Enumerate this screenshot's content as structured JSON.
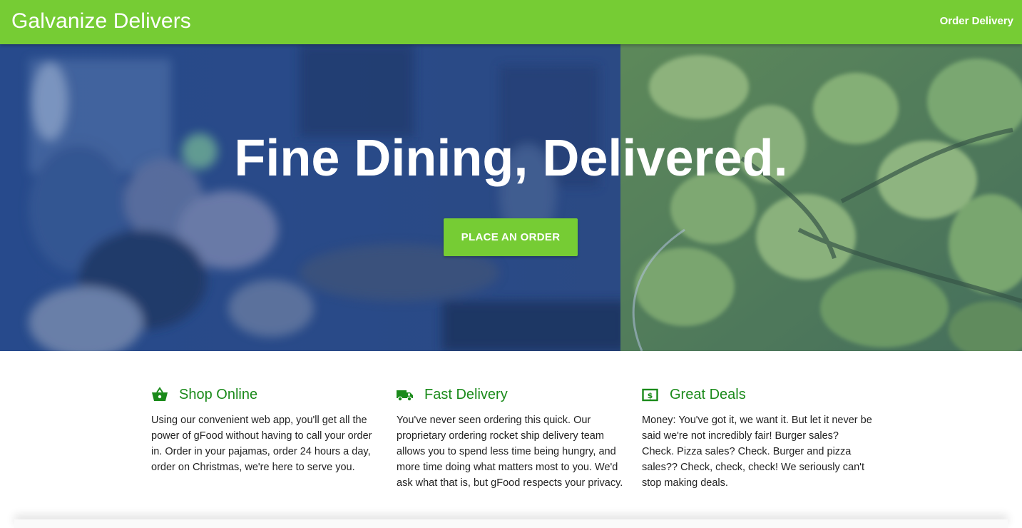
{
  "nav": {
    "brand": "Galvanize Delivers",
    "link": "Order Delivery"
  },
  "hero": {
    "title": "Fine Dining, Delivered.",
    "button": "PLACE AN ORDER"
  },
  "features": [
    {
      "icon": "basket-icon",
      "title": "Shop Online",
      "text": "Using our convenient web app, you'll get all the power of gFood without having to call your order in. Order in your pajamas, order 24 hours a day, order on Christmas, we're here to serve you."
    },
    {
      "icon": "truck-icon",
      "title": "Fast Delivery",
      "text": "You've never seen ordering this quick. Our proprietary ordering rocket ship delivery team allows you to spend less time being hungry, and more time doing what matters most to you. We'd ask what that is, but gFood respects your privacy."
    },
    {
      "icon": "money-icon",
      "title": "Great Deals",
      "text": "Money: You've got it, we want it. But let it never be said we're not incredibly fair! Burger sales? Check. Pizza sales? Check. Burger and pizza sales?? Check, check, check! We seriously can't stop making deals."
    }
  ],
  "colors": {
    "accent": "#76cc34",
    "feature_title": "#1a8a1a",
    "hero_overlay": "#2b4a86"
  }
}
